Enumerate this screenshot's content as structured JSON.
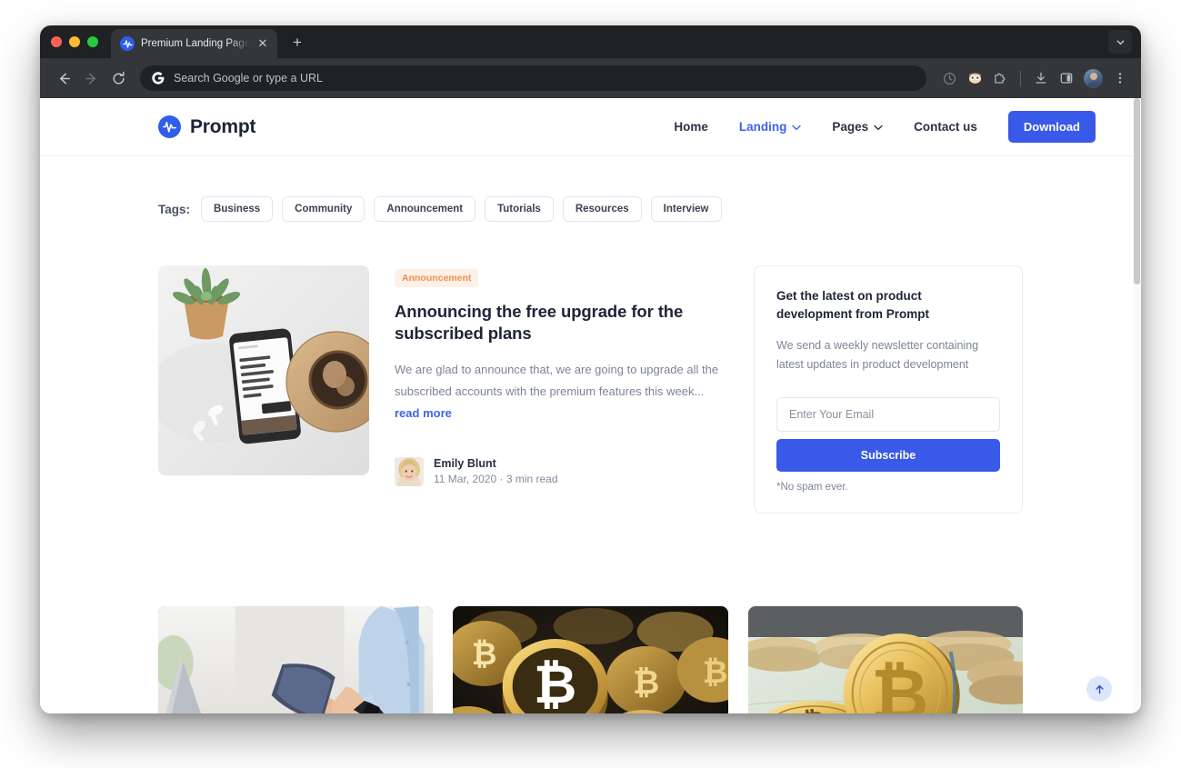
{
  "browser": {
    "tab": {
      "title": "Premium Landing Pages | Pro",
      "favicon_icon": "prompt-logo-icon",
      "close_icon": "close-icon"
    },
    "new_tab_icon": "plus-icon",
    "tab_search_icon": "chevron-down-icon",
    "traffic_lights": [
      "close-red",
      "minimize-yellow",
      "maximize-green"
    ],
    "back_icon": "arrow-left-icon",
    "forward_icon": "arrow-right-icon",
    "reload_icon": "reload-icon",
    "omnibox": {
      "placeholder": "Search Google or type a URL",
      "leading_icon": "google-g-icon"
    },
    "toolbar_icons": [
      "history-clock-icon",
      "extension-puzzle-icon",
      "downloads-icon",
      "side-panel-icon",
      "profile-avatar-icon",
      "three-dot-menu-icon"
    ]
  },
  "site": {
    "brand": {
      "name": "Prompt",
      "mark_icon": "prompt-wave-icon"
    },
    "nav": [
      {
        "label": "Home",
        "active": false,
        "has_chevron": false
      },
      {
        "label": "Landing",
        "active": true,
        "has_chevron": true
      },
      {
        "label": "Pages",
        "active": false,
        "has_chevron": true
      },
      {
        "label": "Contact us",
        "active": false,
        "has_chevron": false
      }
    ],
    "download_label": "Download"
  },
  "tags": {
    "label": "Tags:",
    "items": [
      "Business",
      "Community",
      "Announcement",
      "Tutorials",
      "Resources",
      "Interview"
    ]
  },
  "featured": {
    "thumbnail_alt": "flat-lay desk with succulent plant, smartphone, earbuds and iced coffee",
    "category": "Announcement",
    "title": "Announcing the free upgrade for the subscribed plans",
    "excerpt": "We are glad to announce that, we are going to upgrade all the subscribed accounts with the premium features this week...",
    "read_more": "read more",
    "author": {
      "name": "Emily Blunt",
      "meta": "11 Mar, 2020 · 3 min read",
      "avatar_alt": "portrait of blonde woman"
    }
  },
  "newsletter": {
    "title": "Get the latest on product development from Prompt",
    "description": "We send a weekly newsletter containing latest updates in product development",
    "email_placeholder": "Enter Your Email",
    "email_value": "",
    "subscribe_label": "Subscribe",
    "note": "*No spam ever."
  },
  "posts": [
    {
      "image_alt": "person in light blue shirt using smartphone beside laptop and coffee cup"
    },
    {
      "image_alt": "stack of golden bitcoin coins on dark surface"
    },
    {
      "image_alt": "golden bitcoin coins resting on US dollar bills"
    }
  ],
  "scroll_top": {
    "icon": "arrow-up-icon"
  },
  "colors": {
    "brand_blue": "#3959e8",
    "link_blue": "#3d62ea",
    "badge_orange": "#ef8f4e",
    "badge_orange_bg": "#fdf0e7",
    "text_dark": "#1e2436",
    "text_muted": "#7c8496",
    "chrome_dark": "#35363a",
    "tabstrip_dark": "#202124"
  }
}
